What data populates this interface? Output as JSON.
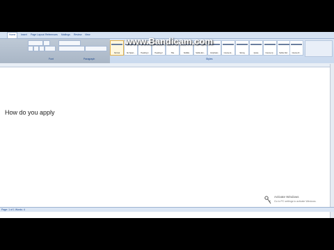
{
  "watermark": "www.Bandicam.com",
  "ribbon": {
    "tabs": [
      "Home",
      "Insert",
      "Page Layout",
      "References",
      "Mailings",
      "Review",
      "View"
    ],
    "group_labels": [
      "Font",
      "Paragraph",
      "Styles"
    ],
    "styles": [
      {
        "name": "Normal"
      },
      {
        "name": "No Spaci..."
      },
      {
        "name": "Heading 1"
      },
      {
        "name": "Heading 2"
      },
      {
        "name": "Title"
      },
      {
        "name": "Subtitle"
      },
      {
        "name": "Subtle Em..."
      },
      {
        "name": "Emphasis"
      },
      {
        "name": "Intense E..."
      },
      {
        "name": "Strong"
      },
      {
        "name": "Quote"
      },
      {
        "name": "Intense Q..."
      },
      {
        "name": "Subtle Ref..."
      },
      {
        "name": "Intense R..."
      }
    ]
  },
  "document": {
    "text": "How do you apply"
  },
  "activate_windows": {
    "title": "Activate Windows",
    "subtitle": "Go to PC settings to activate Windows."
  },
  "status_bar": {
    "text": "Page: 1 of 1    Words: 4"
  }
}
